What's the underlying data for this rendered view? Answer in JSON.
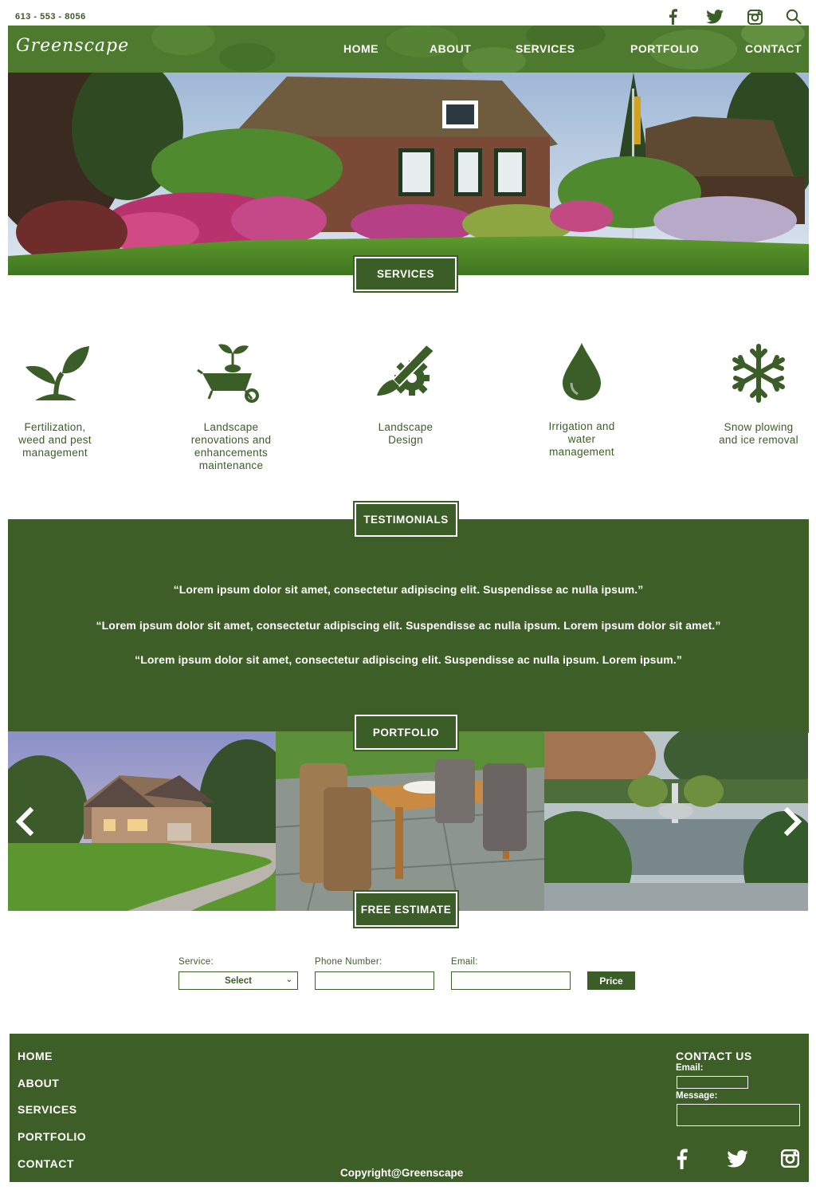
{
  "topbar": {
    "phone": "613 - 553 - 8056",
    "icons": [
      "facebook-icon",
      "twitter-icon",
      "instagram-icon",
      "search-icon"
    ]
  },
  "header": {
    "logo": "Greenscape",
    "nav": [
      "HOME",
      "ABOUT",
      "SERVICES",
      "PORTFOLIO",
      "CONTACT"
    ]
  },
  "services": {
    "title": "SERVICES",
    "items": [
      {
        "icon": "sprout-icon",
        "label_lines": [
          "Fertilization,",
          "weed and pest",
          "management"
        ]
      },
      {
        "icon": "wheelbarrow-icon",
        "label_lines": [
          "Landscape",
          "renovations and",
          "enhancements",
          "maintenance"
        ]
      },
      {
        "icon": "brush-gear-icon",
        "label_lines": [
          "Landscape",
          "Design"
        ]
      },
      {
        "icon": "water-drop-icon",
        "label_lines": [
          "Irrigation and",
          "water",
          "management"
        ]
      },
      {
        "icon": "snowflake-icon",
        "label_lines": [
          "Snow plowing",
          "and ice removal"
        ]
      }
    ]
  },
  "testimonials": {
    "title": "TESTIMONIALS",
    "quotes": [
      "“Lorem ipsum dolor sit amet, consectetur adipiscing elit. Suspendisse ac nulla ipsum.”",
      "“Lorem ipsum dolor sit amet, consectetur adipiscing elit. Suspendisse ac nulla ipsum. Lorem ipsum dolor sit amet.”",
      "“Lorem ipsum dolor sit amet, consectetur adipiscing elit. Suspendisse ac nulla ipsum. Lorem ipsum.”"
    ]
  },
  "portfolio": {
    "title": "PORTFOLIO",
    "prev_icon": "chevron-left-icon",
    "next_icon": "chevron-right-icon"
  },
  "estimate": {
    "title": "FREE ESTIMATE",
    "service_label": "Service:",
    "service_value": "Select",
    "phone_label": "Phone Number:",
    "email_label": "Email:",
    "price_button": "Price"
  },
  "footer": {
    "links": [
      "HOME",
      "ABOUT",
      "SERVICES",
      "PORTFOLIO",
      "CONTACT"
    ],
    "contact_title": "CONTACT US",
    "email_label": "Email:",
    "message_label": "Message:",
    "copyright": "Copyright@Greenscape",
    "icons": [
      "facebook-icon",
      "twitter-icon",
      "instagram-icon"
    ]
  },
  "colors": {
    "brand_green": "#3e5e27",
    "header_green": "#4d7a2e",
    "white": "#ffffff"
  }
}
